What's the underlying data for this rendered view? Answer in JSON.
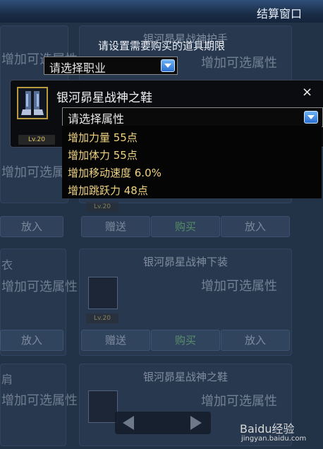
{
  "window": {
    "title": "结算窗口"
  },
  "dialog": {
    "prompt": "请设置需要购买的道具期限",
    "job_select": "请选择职业",
    "item_name": "银河昴星战神之鞋",
    "item_level": "Lv.20",
    "close": "×",
    "attr_select": "请选择属性",
    "attr_options": [
      "增加力量 55点",
      "增加体力 55点",
      "增加移动速度 6.0%",
      "增加跳跃力 48点"
    ]
  },
  "background": {
    "top_card_name": "银河昴星战神护手",
    "top_card_attr": "增加可选属性",
    "mid_card_name": "银河昴星战神下装",
    "mid_card_attr": "增加可选属性",
    "bot_card_name": "银河昴星战神之鞋",
    "bot_card_attr": "增加可选属性",
    "left_attr": "增加可选属性",
    "left_label_mid": "衣",
    "left_label_bot": "肩",
    "gift_label": "赠送",
    "buy_label": "购买",
    "put_label": "放入",
    "lv_label": "Lv.20"
  },
  "watermark": {
    "brand": "Baidu经验",
    "url": "jingyan.baidu.com"
  },
  "colors": {
    "accent": "#2a6fd1",
    "option_text": "#f0d482"
  }
}
